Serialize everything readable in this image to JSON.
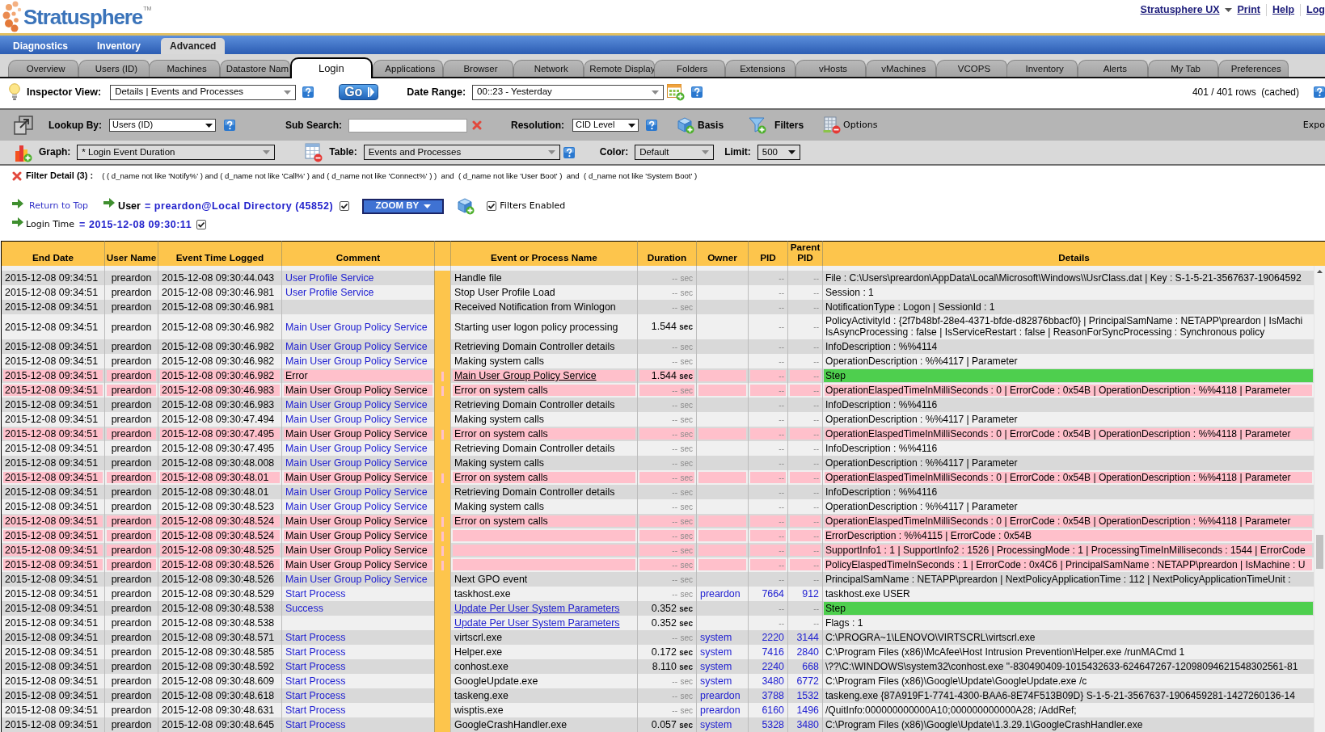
{
  "header": {
    "logo": {
      "name": "Stratusphere",
      "mark": "TM"
    },
    "links": [
      {
        "label": "Stratusphere UX",
        "dropdown": true
      },
      {
        "label": "Print",
        "dropdown": false
      },
      {
        "label": "Help",
        "dropdown": false
      },
      {
        "label": "Log",
        "dropdown": false
      }
    ]
  },
  "main_tabs": [
    {
      "label": "Diagnostics",
      "selected": false
    },
    {
      "label": "Inventory",
      "selected": false
    },
    {
      "label": "Advanced",
      "selected": true
    }
  ],
  "sub_tabs": [
    {
      "label": "Overview",
      "selected": false
    },
    {
      "label": "Users (ID)",
      "selected": false
    },
    {
      "label": "Machines",
      "selected": false
    },
    {
      "label": "Datastore Nam",
      "selected": false
    },
    {
      "label": "Login",
      "selected": true
    },
    {
      "label": "Applications",
      "selected": false
    },
    {
      "label": "Browser",
      "selected": false
    },
    {
      "label": "Network",
      "selected": false
    },
    {
      "label": "Remote Display",
      "selected": false
    },
    {
      "label": "Folders",
      "selected": false
    },
    {
      "label": "Extensions",
      "selected": false
    },
    {
      "label": "vHosts",
      "selected": false
    },
    {
      "label": "vMachines",
      "selected": false
    },
    {
      "label": "VCOPS",
      "selected": false
    },
    {
      "label": "Inventory",
      "selected": false
    },
    {
      "label": "Alerts",
      "selected": false
    },
    {
      "label": "My Tab",
      "selected": false
    },
    {
      "label": "Preferences",
      "selected": false
    }
  ],
  "inspector": {
    "view_label": "Inspector View:",
    "view": "Details | Events and Processes",
    "go": "Go",
    "date_label": "Date Range:",
    "date_range": "00::23 - Yesterday",
    "row_count": "401 / 401 rows  (cached)"
  },
  "query_bar": {
    "lookup_label": "Lookup By:",
    "lookup": "Users (ID)",
    "sub_search_label": "Sub Search:",
    "resolution_label": "Resolution:",
    "resolution": "CID Level",
    "basis": "Basis",
    "filters": "Filters",
    "options": "Options",
    "export": "Expo"
  },
  "display_bar": {
    "graph_label": "Graph:",
    "graph": "* Login Event Duration",
    "table_label": "Table:",
    "table": "Events and Processes",
    "color_label": "Color:",
    "color_mode": "Default",
    "limit_label": "Limit:",
    "limit": "500"
  },
  "filter_detail": {
    "label": "Filter Detail (3) :",
    "expression": "( ( d_name not like 'Notify%' ) and ( d_name not like 'Call%' ) and ( d_name not like 'Connect%' ) )  and  ( d_name not like 'User Boot' )  and  ( d_name not like 'System Boot' )"
  },
  "context": {
    "return_link": "Return to Top",
    "user_label": "User",
    "user_value": "= preardon@Local Directory (45852)",
    "user_checked": true,
    "zoom_button": "ZOOM BY",
    "filters_enabled": "Filters Enabled",
    "filters_checked": true,
    "login_label": "Login Time",
    "login_value": "= 2015-12-08 09:30:11",
    "login_checked": true
  },
  "table": {
    "columns": [
      "End Date",
      "User Name",
      "Event Time Logged",
      "Comment",
      "Event or Process Name",
      "Duration",
      "Owner",
      "PID",
      "Parent PID",
      "Details"
    ],
    "rows": [
      {
        "end_date": "2015-12-08 09:34:51",
        "user": "preardon",
        "event_time": "2015-12-08 09:30:44.043",
        "comment": "User Profile Service",
        "event": "Handle file",
        "event_link": false,
        "duration": "--",
        "duration_unit": "sec",
        "timed": false,
        "kind": "event",
        "pid": "--",
        "parent_pid": "--",
        "details": "File : C:\\Users\\preardon\\AppData\\Local\\Microsoft\\Windows\\\\UsrClass.dat | Key : S-1-5-21-3567637-19064592",
        "error": false,
        "step": false
      },
      {
        "end_date": "2015-12-08 09:34:51",
        "user": "preardon",
        "event_time": "2015-12-08 09:30:46.981",
        "comment": "User Profile Service",
        "event": "Stop User Profile Load",
        "event_link": false,
        "duration": "--",
        "duration_unit": "sec",
        "timed": false,
        "kind": "event",
        "pid": "--",
        "parent_pid": "--",
        "details": "Session : 1",
        "error": false,
        "step": false
      },
      {
        "end_date": "2015-12-08 09:34:51",
        "user": "preardon",
        "event_time": "2015-12-08 09:30:46.981",
        "event": "Received Notification from Winlogon",
        "event_link": false,
        "duration": "--",
        "duration_unit": "sec",
        "timed": false,
        "kind": "event",
        "pid": "--",
        "parent_pid": "--",
        "details": "NotificationType : Logon | SessionId : 1",
        "error": false,
        "step": false
      },
      {
        "end_date": "2015-12-08 09:34:51",
        "user": "preardon",
        "event_time": "2015-12-08 09:30:46.982",
        "comment": "Main User Group Policy Service",
        "event": "Starting user logon policy processing",
        "event_link": false,
        "duration": "1.544",
        "duration_unit": "sec",
        "timed": true,
        "kind": "event",
        "pid": "--",
        "parent_pid": "--",
        "details": [
          "PolicyActivityId : {2f7b48bf-28e4-4371-bfde-d82876bbacf0} | PrincipalSamName : NETAPP\\preardon | IsMachi",
          "IsAsyncProcessing : false | IsServiceRestart : false | ReasonForSyncProcessing : Synchronous policy"
        ],
        "error": false,
        "step": false
      },
      {
        "end_date": "2015-12-08 09:34:51",
        "user": "preardon",
        "event_time": "2015-12-08 09:30:46.982",
        "comment": "Main User Group Policy Service",
        "event": "Retrieving Domain Controller details",
        "event_link": false,
        "duration": "--",
        "duration_unit": "sec",
        "timed": false,
        "kind": "event",
        "pid": "--",
        "parent_pid": "--",
        "details": "InfoDescription : %%4114",
        "error": false,
        "step": false
      },
      {
        "end_date": "2015-12-08 09:34:51",
        "user": "preardon",
        "event_time": "2015-12-08 09:30:46.982",
        "comment": "Main User Group Policy Service",
        "event": "Making system calls",
        "event_link": false,
        "duration": "--",
        "duration_unit": "sec",
        "timed": false,
        "kind": "event",
        "pid": "--",
        "parent_pid": "--",
        "details": "OperationDescription : %%4117 | Parameter",
        "error": false,
        "step": false
      },
      {
        "end_date": "2015-12-08 09:34:51",
        "user": "preardon",
        "event_time": "2015-12-08 09:30:46.982",
        "comment": "Error",
        "event": "Main User Group Policy Service",
        "event_link": true,
        "duration": "1.544",
        "duration_unit": "sec",
        "timed": true,
        "kind": "event",
        "pid": "--",
        "parent_pid": "--",
        "details": "Step",
        "error": true,
        "step": true
      },
      {
        "end_date": "2015-12-08 09:34:51",
        "user": "preardon",
        "event_time": "2015-12-08 09:30:46.983",
        "comment": "Main User Group Policy Service",
        "event": "Error on system calls",
        "event_link": false,
        "duration": "--",
        "duration_unit": "sec",
        "timed": false,
        "kind": "event",
        "pid": "--",
        "parent_pid": "--",
        "details": "OperationElaspedTimeInMilliSeconds : 0 | ErrorCode : 0x54B | OperationDescription : %%4118 | Parameter",
        "error": true,
        "step": false
      },
      {
        "end_date": "2015-12-08 09:34:51",
        "user": "preardon",
        "event_time": "2015-12-08 09:30:46.983",
        "comment": "Main User Group Policy Service",
        "event": "Retrieving Domain Controller details",
        "event_link": false,
        "duration": "--",
        "duration_unit": "sec",
        "timed": false,
        "kind": "event",
        "pid": "--",
        "parent_pid": "--",
        "details": "InfoDescription : %%4116",
        "error": false,
        "step": false
      },
      {
        "end_date": "2015-12-08 09:34:51",
        "user": "preardon",
        "event_time": "2015-12-08 09:30:47.494",
        "comment": "Main User Group Policy Service",
        "event": "Making system calls",
        "event_link": false,
        "duration": "--",
        "duration_unit": "sec",
        "timed": false,
        "kind": "event",
        "pid": "--",
        "parent_pid": "--",
        "details": "OperationDescription : %%4117 | Parameter",
        "error": false,
        "step": false
      },
      {
        "end_date": "2015-12-08 09:34:51",
        "user": "preardon",
        "event_time": "2015-12-08 09:30:47.495",
        "comment": "Main User Group Policy Service",
        "event": "Error on system calls",
        "event_link": false,
        "duration": "--",
        "duration_unit": "sec",
        "timed": false,
        "kind": "event",
        "pid": "--",
        "parent_pid": "--",
        "details": "OperationElaspedTimeInMilliSeconds : 0 | ErrorCode : 0x54B | OperationDescription : %%4118 | Parameter",
        "error": true,
        "step": false
      },
      {
        "end_date": "2015-12-08 09:34:51",
        "user": "preardon",
        "event_time": "2015-12-08 09:30:47.495",
        "comment": "Main User Group Policy Service",
        "event": "Retrieving Domain Controller details",
        "event_link": false,
        "duration": "--",
        "duration_unit": "sec",
        "timed": false,
        "kind": "event",
        "pid": "--",
        "parent_pid": "--",
        "details": "InfoDescription : %%4116",
        "error": false,
        "step": false
      },
      {
        "end_date": "2015-12-08 09:34:51",
        "user": "preardon",
        "event_time": "2015-12-08 09:30:48.008",
        "comment": "Main User Group Policy Service",
        "event": "Making system calls",
        "event_link": false,
        "duration": "--",
        "duration_unit": "sec",
        "timed": false,
        "kind": "event",
        "pid": "--",
        "parent_pid": "--",
        "details": "OperationDescription : %%4117 | Parameter",
        "error": false,
        "step": false
      },
      {
        "end_date": "2015-12-08 09:34:51",
        "user": "preardon",
        "event_time": "2015-12-08 09:30:48.01",
        "comment": "Main User Group Policy Service",
        "event": "Error on system calls",
        "event_link": false,
        "duration": "--",
        "duration_unit": "sec",
        "timed": false,
        "kind": "event",
        "pid": "--",
        "parent_pid": "--",
        "details": "OperationElaspedTimeInMilliSeconds : 0 | ErrorCode : 0x54B | OperationDescription : %%4118 | Parameter",
        "error": true,
        "step": false
      },
      {
        "end_date": "2015-12-08 09:34:51",
        "user": "preardon",
        "event_time": "2015-12-08 09:30:48.01",
        "comment": "Main User Group Policy Service",
        "event": "Retrieving Domain Controller details",
        "event_link": false,
        "duration": "--",
        "duration_unit": "sec",
        "timed": false,
        "kind": "event",
        "pid": "--",
        "parent_pid": "--",
        "details": "InfoDescription : %%4116",
        "error": false,
        "step": false
      },
      {
        "end_date": "2015-12-08 09:34:51",
        "user": "preardon",
        "event_time": "2015-12-08 09:30:48.523",
        "comment": "Main User Group Policy Service",
        "event": "Making system calls",
        "event_link": false,
        "duration": "--",
        "duration_unit": "sec",
        "timed": false,
        "kind": "event",
        "pid": "--",
        "parent_pid": "--",
        "details": "OperationDescription : %%4117 | Parameter",
        "error": false,
        "step": false
      },
      {
        "end_date": "2015-12-08 09:34:51",
        "user": "preardon",
        "event_time": "2015-12-08 09:30:48.524",
        "comment": "Main User Group Policy Service",
        "event": "Error on system calls",
        "event_link": false,
        "duration": "--",
        "duration_unit": "sec",
        "timed": false,
        "kind": "event",
        "pid": "--",
        "parent_pid": "--",
        "details": "OperationElaspedTimeInMilliSeconds : 0 | ErrorCode : 0x54B | OperationDescription : %%4118 | Parameter",
        "error": true,
        "step": false
      },
      {
        "end_date": "2015-12-08 09:34:51",
        "user": "preardon",
        "event_time": "2015-12-08 09:30:48.524",
        "comment": "Main User Group Policy Service",
        "duration": "--",
        "duration_unit": "sec",
        "timed": false,
        "kind": "event",
        "pid": "--",
        "parent_pid": "--",
        "details": "ErrorDescription : %%4115 | ErrorCode : 0x54B",
        "error": true,
        "step": false
      },
      {
        "end_date": "2015-12-08 09:34:51",
        "user": "preardon",
        "event_time": "2015-12-08 09:30:48.525",
        "comment": "Main User Group Policy Service",
        "duration": "--",
        "duration_unit": "sec",
        "timed": false,
        "kind": "event",
        "pid": "--",
        "parent_pid": "--",
        "details": "SupportInfo1 : 1 | SupportInfo2 : 1526 | ProcessingMode : 1 | ProcessingTimeInMilliseconds : 1544 | ErrorCode",
        "error": true,
        "step": false
      },
      {
        "end_date": "2015-12-08 09:34:51",
        "user": "preardon",
        "event_time": "2015-12-08 09:30:48.526",
        "comment": "Main User Group Policy Service",
        "duration": "--",
        "duration_unit": "sec",
        "timed": false,
        "kind": "event",
        "pid": "--",
        "parent_pid": "--",
        "details": "PolicyElaspedTimeInSeconds : 1 | ErrorCode : 0x4C6 | PrincipalSamName : NETAPP\\preardon | IsMachine : U",
        "error": true,
        "step": false
      },
      {
        "end_date": "2015-12-08 09:34:51",
        "user": "preardon",
        "event_time": "2015-12-08 09:30:48.526",
        "comment": "Main User Group Policy Service",
        "event": "Next GPO event",
        "event_link": false,
        "duration": "--",
        "duration_unit": "sec",
        "timed": false,
        "kind": "event",
        "pid": "--",
        "parent_pid": "--",
        "details": "PrincipalSamName : NETAPP\\preardon | NextPolicyApplicationTime : 112 | NextPolicyApplicationTimeUnit :",
        "error": false,
        "step": false
      },
      {
        "end_date": "2015-12-08 09:34:51",
        "user": "preardon",
        "event_time": "2015-12-08 09:30:48.529",
        "comment": "Start Process",
        "event": "taskhost.exe",
        "event_link": false,
        "duration": "--",
        "duration_unit": "sec",
        "timed": false,
        "kind": "process",
        "owner": "preardon",
        "pid": "7664",
        "parent_pid": "912",
        "details": "taskhost.exe USER",
        "error": false,
        "step": false
      },
      {
        "end_date": "2015-12-08 09:34:51",
        "user": "preardon",
        "event_time": "2015-12-08 09:30:48.538",
        "comment": "Success",
        "event": "Update Per User System Parameters",
        "event_link": true,
        "duration": "0.352",
        "duration_unit": "sec",
        "timed": true,
        "kind": "event",
        "pid": "--",
        "parent_pid": "--",
        "details": "Step",
        "error": false,
        "step": true
      },
      {
        "end_date": "2015-12-08 09:34:51",
        "user": "preardon",
        "event_time": "2015-12-08 09:30:48.538",
        "event": "Update Per User System Parameters",
        "event_link": true,
        "duration": "0.352",
        "duration_unit": "sec",
        "timed": true,
        "kind": "event",
        "pid": "--",
        "parent_pid": "--",
        "details": "Flags : 1",
        "error": false,
        "step": false
      },
      {
        "end_date": "2015-12-08 09:34:51",
        "user": "preardon",
        "event_time": "2015-12-08 09:30:48.571",
        "comment": "Start Process",
        "event": "virtscrl.exe",
        "event_link": false,
        "duration": "--",
        "duration_unit": "sec",
        "timed": false,
        "kind": "process",
        "owner": "system",
        "pid": "2220",
        "parent_pid": "3144",
        "details": "C:\\PROGRA~1\\LENOVO\\VIRTSCRL\\virtscrl.exe",
        "error": false,
        "step": false
      },
      {
        "end_date": "2015-12-08 09:34:51",
        "user": "preardon",
        "event_time": "2015-12-08 09:30:48.585",
        "comment": "Start Process",
        "event": "Helper.exe",
        "event_link": false,
        "duration": "0.172",
        "duration_unit": "sec",
        "timed": true,
        "kind": "process",
        "owner": "system",
        "pid": "7416",
        "parent_pid": "2840",
        "details": "C:\\Program Files (x86)\\McAfee\\Host Intrusion Prevention\\Helper.exe /runMACmd 1",
        "error": false,
        "step": false
      },
      {
        "end_date": "2015-12-08 09:34:51",
        "user": "preardon",
        "event_time": "2015-12-08 09:30:48.592",
        "comment": "Start Process",
        "event": "conhost.exe",
        "event_link": false,
        "duration": "8.110",
        "duration_unit": "sec",
        "timed": true,
        "kind": "process",
        "owner": "system",
        "pid": "2240",
        "parent_pid": "668",
        "details": "\\??\\C:\\WINDOWS\\system32\\conhost.exe \"-830490409-1015432633-624647267-12098094621548302561-81",
        "error": false,
        "step": false
      },
      {
        "end_date": "2015-12-08 09:34:51",
        "user": "preardon",
        "event_time": "2015-12-08 09:30:48.609",
        "comment": "Start Process",
        "event": "GoogleUpdate.exe",
        "event_link": false,
        "duration": "--",
        "duration_unit": "sec",
        "timed": false,
        "kind": "process",
        "owner": "system",
        "pid": "3480",
        "parent_pid": "6772",
        "details": "C:\\Program Files (x86)\\Google\\Update\\GoogleUpdate.exe /c",
        "error": false,
        "step": false
      },
      {
        "end_date": "2015-12-08 09:34:51",
        "user": "preardon",
        "event_time": "2015-12-08 09:30:48.618",
        "comment": "Start Process",
        "event": "taskeng.exe",
        "event_link": false,
        "duration": "--",
        "duration_unit": "sec",
        "timed": false,
        "kind": "process",
        "owner": "preardon",
        "pid": "3788",
        "parent_pid": "1532",
        "details": "taskeng.exe {87A919F1-7741-4300-BAA6-8E74F513B09D} S-1-5-21-3567637-1906459281-1427260136-14",
        "error": false,
        "step": false
      },
      {
        "end_date": "2015-12-08 09:34:51",
        "user": "preardon",
        "event_time": "2015-12-08 09:30:48.631",
        "comment": "Start Process",
        "event": "wisptis.exe",
        "event_link": false,
        "duration": "--",
        "duration_unit": "sec",
        "timed": false,
        "kind": "process",
        "owner": "preardon",
        "pid": "6160",
        "parent_pid": "1496",
        "details": "/QuitInfo:000000000000A10;000000000000A28; /AddRef;",
        "error": false,
        "step": false
      },
      {
        "end_date": "2015-12-08 09:34:51",
        "user": "preardon",
        "event_time": "2015-12-08 09:30:48.645",
        "comment": "Start Process",
        "event": "GoogleCrashHandler.exe",
        "event_link": false,
        "duration": "0.057",
        "duration_unit": "sec",
        "timed": true,
        "kind": "process",
        "owner": "system",
        "pid": "5328",
        "parent_pid": "3480",
        "details": "C:\\Program Files (x86)\\Google\\Update\\1.3.29.1\\GoogleCrashHandler.exe",
        "error": false,
        "step": false
      }
    ]
  }
}
